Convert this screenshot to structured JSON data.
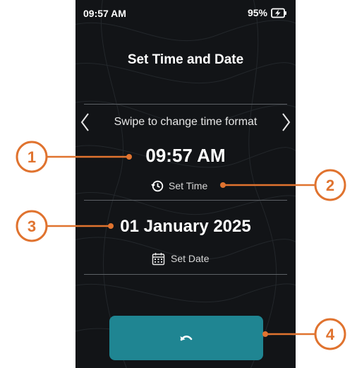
{
  "status_bar": {
    "time": "09:57 AM",
    "battery_percent": "95%",
    "battery_icon": "battery-charging-icon"
  },
  "screen": {
    "title": "Set Time and Date",
    "time_format_hint": "Swipe to change time format",
    "time_value": "09:57 AM",
    "set_time_label": "Set Time",
    "date_value": "01 January 2025",
    "set_date_label": "Set Date",
    "back_icon": "undo-arrow-icon"
  },
  "callouts": {
    "items": [
      {
        "number": "1",
        "target": "time-value"
      },
      {
        "number": "2",
        "target": "set-time-button"
      },
      {
        "number": "3",
        "target": "date-value"
      },
      {
        "number": "4",
        "target": "back-button"
      }
    ]
  },
  "colors": {
    "screen_background": "#121417",
    "button_teal": "#1f8592",
    "callout_orange": "#e0732f",
    "divider": "#5d6166"
  }
}
